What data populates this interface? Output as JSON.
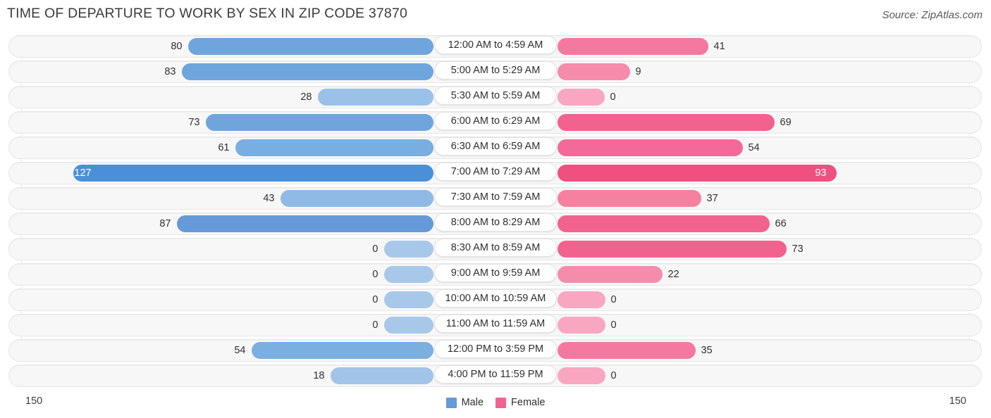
{
  "header": {
    "title": "TIME OF DEPARTURE TO WORK BY SEX IN ZIP CODE 37870",
    "source": "Source: ZipAtlas.com"
  },
  "axis": {
    "left_label": "150",
    "right_label": "150"
  },
  "legend": {
    "items": [
      {
        "label": "Male",
        "color": "#6699d8"
      },
      {
        "label": "Female",
        "color": "#f2628f"
      }
    ]
  },
  "colors": {
    "male_strong": "#4a90d9",
    "male_mid": "#71a8de",
    "male_light": "#a8c8ea",
    "female_strong": "#f0507f",
    "female_mid": "#f4789f",
    "female_light": "#f9a7c1",
    "track": "#f7f7f7",
    "grid": "#e8e8e8"
  },
  "chart_data": {
    "type": "bar",
    "title": "TIME OF DEPARTURE TO WORK BY SEX IN ZIP CODE 37870",
    "subtitle": "",
    "xlabel": "",
    "ylabel": "",
    "orientation": "horizontal-diverging",
    "grid": true,
    "legend_position": "bottom-center",
    "axis_max": 150,
    "xlim": [
      150,
      150
    ],
    "categories": [
      "12:00 AM to 4:59 AM",
      "5:00 AM to 5:29 AM",
      "5:30 AM to 5:59 AM",
      "6:00 AM to 6:29 AM",
      "6:30 AM to 6:59 AM",
      "7:00 AM to 7:29 AM",
      "7:30 AM to 7:59 AM",
      "8:00 AM to 8:29 AM",
      "8:30 AM to 8:59 AM",
      "9:00 AM to 9:59 AM",
      "10:00 AM to 10:59 AM",
      "11:00 AM to 11:59 AM",
      "12:00 PM to 3:59 PM",
      "4:00 PM to 11:59 PM"
    ],
    "series": [
      {
        "name": "Male",
        "values": [
          80,
          83,
          28,
          73,
          61,
          127,
          43,
          87,
          0,
          0,
          0,
          0,
          54,
          18
        ]
      },
      {
        "name": "Female",
        "values": [
          41,
          9,
          0,
          69,
          54,
          93,
          37,
          66,
          73,
          22,
          0,
          0,
          35,
          0
        ]
      }
    ]
  },
  "rows": [
    {
      "label": "12:00 AM to 4:59 AM",
      "male": "80",
      "female": "41",
      "male_w": 348,
      "female_w": 214,
      "male_c": "#6ea5dd",
      "female_c": "#f4789f",
      "male_in": false,
      "female_in": false
    },
    {
      "label": "5:00 AM to 5:29 AM",
      "male": "83",
      "female": "9",
      "male_w": 357,
      "female_w": 103,
      "male_c": "#6ea5dd",
      "female_c": "#f68cac",
      "male_in": false,
      "female_in": false
    },
    {
      "label": "5:30 AM to 5:59 AM",
      "male": "28",
      "female": "0",
      "male_w": 164,
      "female_w": 67,
      "male_c": "#9ac1e8",
      "female_c": "#f9a7c1",
      "male_in": false,
      "female_in": false
    },
    {
      "label": "6:00 AM to 6:29 AM",
      "male": "73",
      "female": "69",
      "male_w": 323,
      "female_w": 308,
      "male_c": "#6ea5dd",
      "female_c": "#f2628f",
      "male_in": false,
      "female_in": false
    },
    {
      "label": "6:30 AM to 6:59 AM",
      "male": "61",
      "female": "54",
      "male_w": 281,
      "female_w": 263,
      "male_c": "#78aee0",
      "female_c": "#f3699a",
      "male_in": false,
      "female_in": false
    },
    {
      "label": "7:00 AM to 7:29 AM",
      "male": "127",
      "female": "93",
      "male_w": 511,
      "female_w": 396,
      "male_c": "#4a90d9",
      "female_c": "#f0507f",
      "male_in": true,
      "female_in": true
    },
    {
      "label": "7:30 AM to 7:59 AM",
      "male": "43",
      "female": "37",
      "male_w": 217,
      "female_w": 204,
      "male_c": "#8fbae5",
      "female_c": "#f6819f",
      "male_in": false,
      "female_in": false
    },
    {
      "label": "8:00 AM to 8:29 AM",
      "male": "87",
      "female": "66",
      "male_w": 364,
      "female_w": 301,
      "male_c": "#6699d8",
      "female_c": "#f2628f",
      "male_in": false,
      "female_in": false
    },
    {
      "label": "8:30 AM to 8:59 AM",
      "male": "0",
      "female": "73",
      "male_w": 70,
      "female_w": 325,
      "male_c": "#a8c8ea",
      "female_c": "#f2628f",
      "male_in": false,
      "female_in": false
    },
    {
      "label": "9:00 AM to 9:59 AM",
      "male": "0",
      "female": "22",
      "male_w": 70,
      "female_w": 149,
      "male_c": "#a8c8ea",
      "female_c": "#f68cac",
      "male_in": false,
      "female_in": false
    },
    {
      "label": "10:00 AM to 10:59 AM",
      "male": "0",
      "female": "0",
      "male_w": 70,
      "female_w": 68,
      "male_c": "#a8c8ea",
      "female_c": "#f9a7c1",
      "male_in": false,
      "female_in": false
    },
    {
      "label": "11:00 AM to 11:59 AM",
      "male": "0",
      "female": "0",
      "male_w": 70,
      "female_w": 68,
      "male_c": "#a8c8ea",
      "female_c": "#f9a7c1",
      "male_in": false,
      "female_in": false
    },
    {
      "label": "12:00 PM to 3:59 PM",
      "male": "54",
      "female": "35",
      "male_w": 258,
      "female_w": 196,
      "male_c": "#7aafe0",
      "female_c": "#f4789f",
      "male_in": false,
      "female_in": false
    },
    {
      "label": "4:00 PM to 11:59 PM",
      "male": "18",
      "female": "0",
      "male_w": 146,
      "female_w": 68,
      "male_c": "#a2c4e9",
      "female_c": "#f9a7c1",
      "male_in": false,
      "female_in": false
    }
  ]
}
